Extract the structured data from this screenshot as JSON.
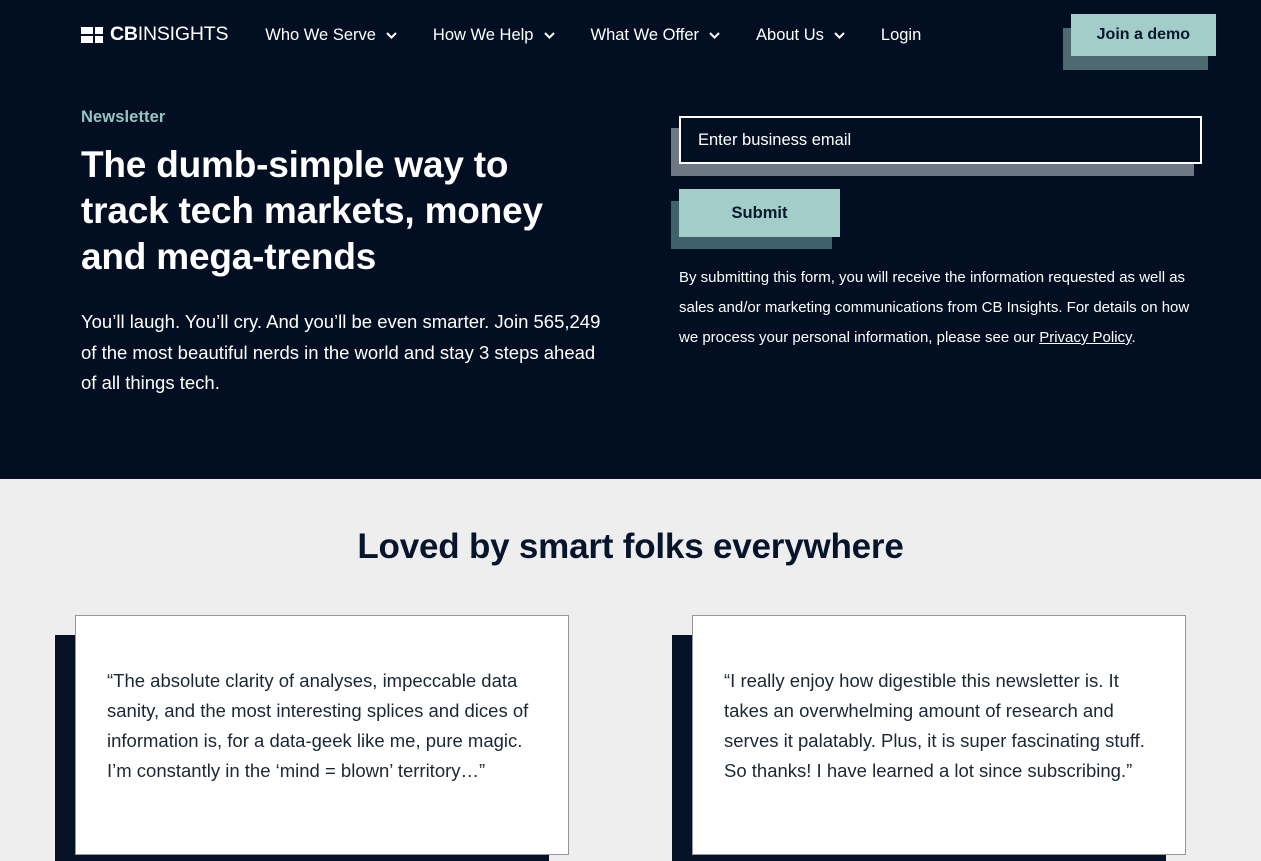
{
  "brand": {
    "logo_mark": "cb-insights-blocks-icon",
    "logo_bold": "CB",
    "logo_light": "INSIGHTS"
  },
  "nav": {
    "items": [
      {
        "label": "Who We Serve",
        "has_chevron": true,
        "icon": "chevron-down-icon"
      },
      {
        "label": "How We Help",
        "has_chevron": true,
        "icon": "chevron-down-icon"
      },
      {
        "label": "What We Offer",
        "has_chevron": true,
        "icon": "chevron-down-icon"
      },
      {
        "label": "About Us",
        "has_chevron": true,
        "icon": "chevron-down-icon"
      },
      {
        "label": "Login",
        "has_chevron": false,
        "icon": ""
      }
    ],
    "cta_label": "Join a demo"
  },
  "hero": {
    "eyebrow": "Newsletter",
    "title": "The dumb-simple way to track tech markets, money and mega-trends",
    "copy": "You’ll laugh. You’ll cry. And you’ll be even smarter. Join 565,249 of the most beautiful nerds in the world and stay 3 steps ahead of all things tech.",
    "subscriber_count": "565,249"
  },
  "form": {
    "email_placeholder": "Enter business email",
    "email_value": "",
    "submit_label": "Submit",
    "disclaimer_part1": "By submitting this form, you will receive the information requested as well as sales and/or marketing communications from CB Insights. For details on how we process your personal information, please see our ",
    "privacy_link_label": "Privacy Policy",
    "disclaimer_part2": "."
  },
  "testimonials": {
    "heading": "Loved by smart folks everywhere",
    "cards": [
      {
        "quote": "“The absolute clarity of analyses, impeccable data sanity, and the most interesting splices and dices of information is, for a data-geek like me, pure magic. I’m constantly in the ‘mind = blown’ territory…”"
      },
      {
        "quote": "“I really enjoy how digestible this newsletter is. It takes an overwhelming amount of research and serves it palatably. Plus, it is super fascinating stuff. So thanks! I have learned a lot since subscribing.”"
      }
    ]
  },
  "colors": {
    "hero_bg": "#020f23",
    "section_bg": "#eeeeee",
    "accent_mint": "#a2cdc9",
    "eyebrow_teal": "#97c6c2",
    "shadow_navy": "#061227",
    "text_dark": "#06152b"
  }
}
